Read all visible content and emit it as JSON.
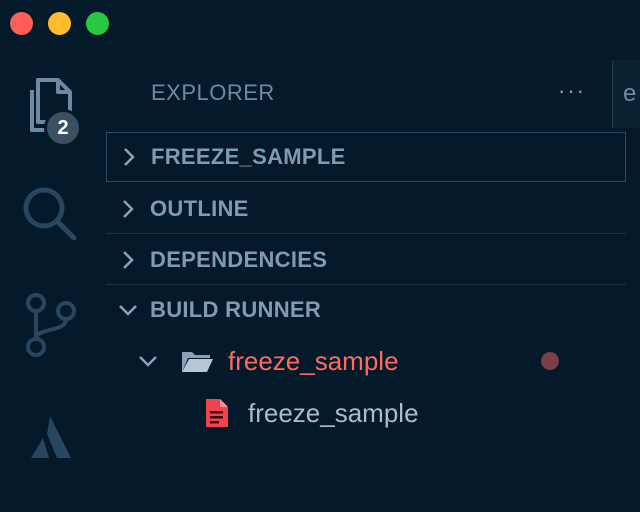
{
  "window": {
    "controls": [
      "close",
      "minimize",
      "zoom"
    ]
  },
  "activity_bar": {
    "items": [
      {
        "name": "explorer",
        "icon": "files-icon",
        "badge": "2"
      },
      {
        "name": "search",
        "icon": "search-icon"
      },
      {
        "name": "source-control",
        "icon": "source-control-icon"
      },
      {
        "name": "atlassian",
        "icon": "atlassian-icon"
      }
    ]
  },
  "explorer": {
    "title": "EXPLORER",
    "more": "···",
    "tab_stub": "e"
  },
  "sections": [
    {
      "label": "FREEZE_SAMPLE",
      "expanded": false
    },
    {
      "label": "OUTLINE",
      "expanded": false
    },
    {
      "label": "DEPENDENCIES",
      "expanded": false
    },
    {
      "label": "BUILD RUNNER",
      "expanded": true
    }
  ],
  "build_runner": {
    "folder": {
      "label": "freeze_sample",
      "color": "#ff6a5f"
    },
    "file": {
      "label": "freeze_sample",
      "icon_color": "#f0434f"
    }
  }
}
